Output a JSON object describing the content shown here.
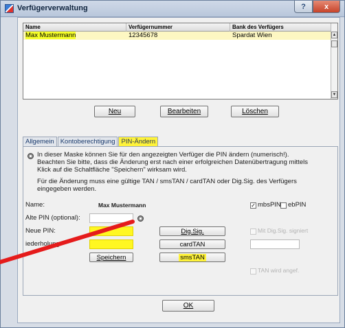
{
  "window": {
    "title": "Verfügerverwaltung",
    "help_glyph": "?",
    "close_glyph": "x"
  },
  "table": {
    "columns": [
      "Name",
      "Verfügernummer",
      "Bank des Verfügers"
    ],
    "rows": [
      {
        "name": "Max Mustermann",
        "number": "12345678",
        "bank": "Spardat Wien"
      }
    ]
  },
  "buttons": {
    "new": "Neu",
    "edit": "Bearbeiten",
    "delete": "Löschen",
    "ok": "OK"
  },
  "tabs": [
    {
      "label": "Allgemein"
    },
    {
      "label": "Kontoberechtigung"
    },
    {
      "label": "PIN-Ändern",
      "active": true
    }
  ],
  "pin_tab": {
    "info_lines": [
      "In dieser Maske können Sie für den angezeigten Verfüger die PIN ändern (numerisch!).",
      "Beachten Sie bitte, dass die Änderung erst nach einer erfolgreichen Datenübertragung mittels",
      "Klick auf die Schaltfläche \"Speichern\" wirksam wird."
    ],
    "info_lines_2": [
      "Für die Änderung muss eine gültige TAN / smsTAN / cardTAN oder Dig.Sig. des Verfügers",
      "eingegeben werden."
    ],
    "name_label": "Name:",
    "name_value": "Max Mustermann",
    "old_pin_label": "Alte PIN (optional):",
    "new_pin_label": "Neue PIN:",
    "repeat_label": "Wiederholung:",
    "repeat_label_visible": "iederholung:",
    "mbspin_label": "mbsPIN",
    "ebpin_label": "ebPIN",
    "mbspin_checked": true,
    "ebpin_checked": false,
    "digsig_button": "Dig.Sig.",
    "cardtan_button": "cardTAN",
    "smstan_button": "smsTAN",
    "save_button": "Speichern",
    "digsig_check_label": "Mit Dig.Sig. signiert",
    "tan_check_label": "TAN wird angef.",
    "check_mark": "✓"
  },
  "colors": {
    "highlight_yellow": "#fff33a",
    "annotation_red": "#e51b1b"
  }
}
